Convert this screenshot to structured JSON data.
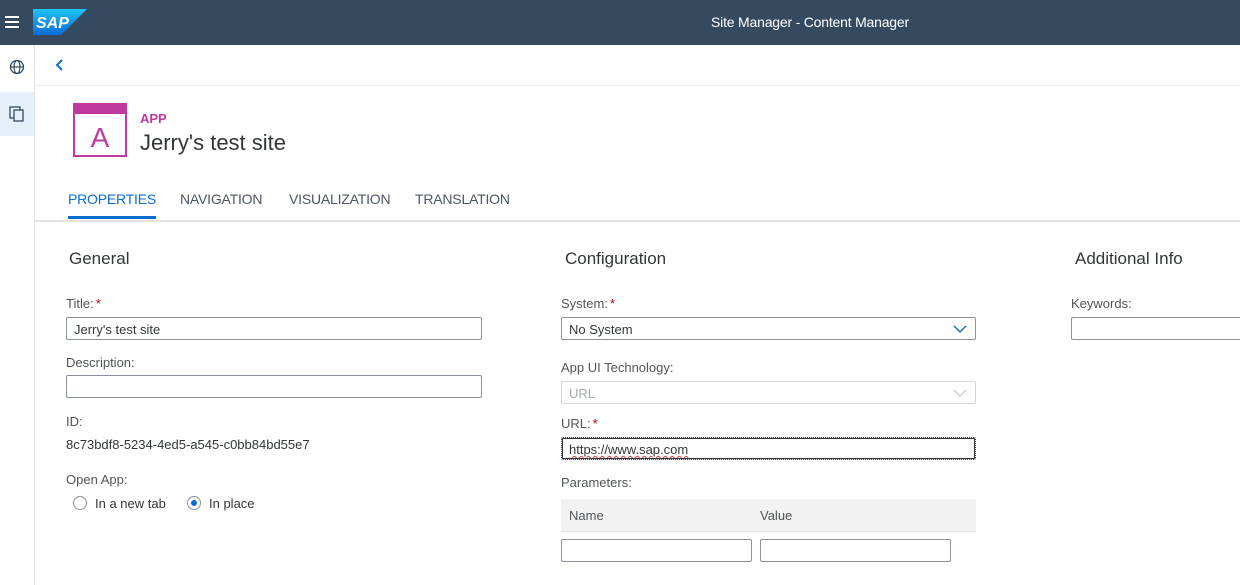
{
  "shell": {
    "title": "Site Manager - Content Manager",
    "logo_text": "SAP",
    "menu_icon": "hamburger-icon"
  },
  "sidenav": {
    "items": [
      {
        "icon": "globe-icon",
        "selected": false
      },
      {
        "icon": "content-copy-icon",
        "selected": true
      }
    ]
  },
  "back_icon": "chevron-left-icon",
  "header": {
    "icon_letter": "A",
    "kind": "APP",
    "title": "Jerry's test site"
  },
  "tabs": [
    {
      "label": "PROPERTIES",
      "active": true
    },
    {
      "label": "NAVIGATION",
      "active": false
    },
    {
      "label": "VISUALIZATION",
      "active": false
    },
    {
      "label": "TRANSLATION",
      "active": false
    }
  ],
  "general": {
    "heading": "General",
    "title_label": "Title:",
    "title_value": "Jerry's test site",
    "description_label": "Description:",
    "description_value": "",
    "id_label": "ID:",
    "id_value": "8c73bdf8-5234-4ed5-a545-c0bb84bd55e7",
    "open_app_label": "Open App:",
    "open_app_options": [
      {
        "label": "In a new tab",
        "selected": false
      },
      {
        "label": "In place",
        "selected": true
      }
    ]
  },
  "configuration": {
    "heading": "Configuration",
    "system_label": "System:",
    "system_value": "No System",
    "tech_label": "App UI Technology:",
    "tech_value": "URL",
    "url_label": "URL:",
    "url_value": "https://www.sap.com",
    "params_label": "Parameters:",
    "params_columns": [
      "Name",
      "Value"
    ]
  },
  "additional": {
    "heading": "Additional Info",
    "keywords_label": "Keywords:",
    "keywords_value": ""
  },
  "colors": {
    "shell": "#354a5f",
    "accent": "#0a6ed1",
    "app_icon": "#c0399f",
    "required": "#bb0000"
  }
}
